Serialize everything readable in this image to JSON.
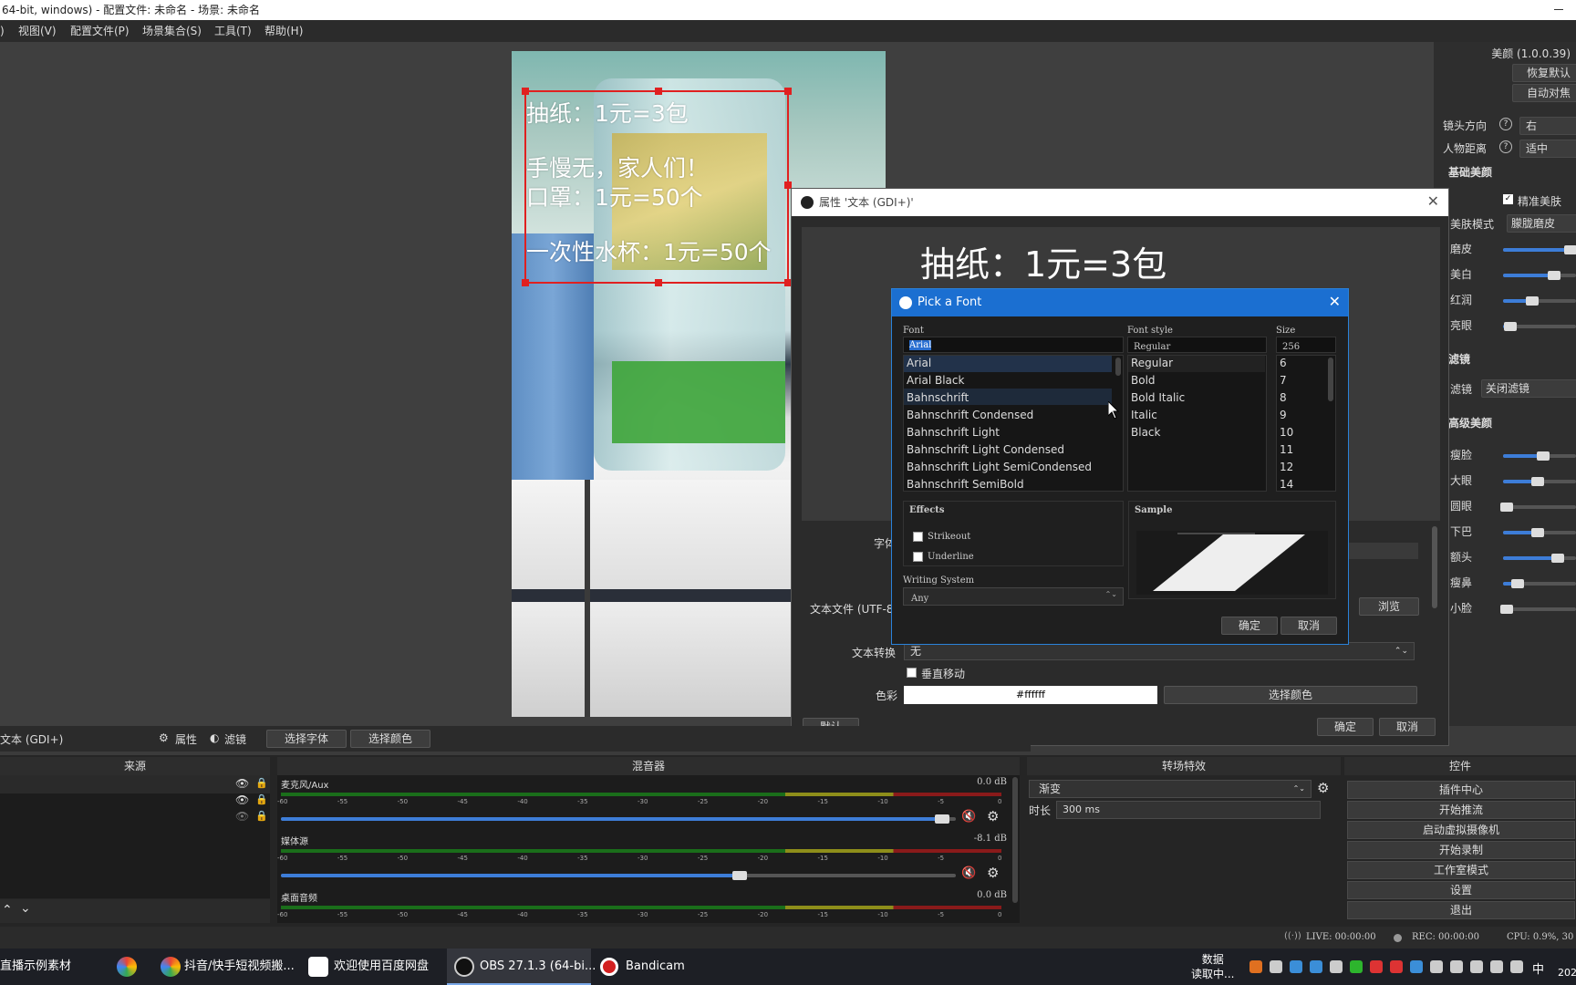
{
  "window": {
    "title": "64-bit, windows) - 配置文件: 未命名 - 场景: 未命名"
  },
  "menu": [
    "视图(V)",
    "配置文件(P)",
    "场景集合(S)",
    "工具(T)",
    "帮助(H)"
  ],
  "overlay": {
    "line1": "抽纸：1元=3包",
    "line2": "手慢无，家人们！",
    "line3": "口罩：1元=50个",
    "line4": "一次性水杯：1元=50个"
  },
  "right_panel": {
    "version": "美颜 (1.0.0.39)",
    "restore_btn": "恢复默认",
    "auto_btn": "自动对焦",
    "lens_dir_label": "镜头方向",
    "lens_dir_value": "右",
    "distance_label": "人物距离",
    "distance_value": "适中",
    "basic_title": "基础美颜",
    "precise_label": "精准美肤",
    "skin_mode_label": "美肤模式",
    "skin_mode_value": "朦胧磨皮",
    "sliders_basic": [
      {
        "label": "磨皮",
        "level": 0.92
      },
      {
        "label": "美白",
        "level": 0.7
      },
      {
        "label": "红润",
        "level": 0.4
      },
      {
        "label": "亮眼",
        "level": 0.1
      }
    ],
    "filter_title": "滤镜",
    "filter_label": "滤镜",
    "filter_value": "关闭滤镜",
    "advanced_title": "高级美颜",
    "sliders_adv": [
      {
        "label": "瘦脸",
        "level": 0.55
      },
      {
        "label": "大眼",
        "level": 0.48
      },
      {
        "label": "圆眼",
        "level": 0.05
      },
      {
        "label": "下巴",
        "level": 0.48
      },
      {
        "label": "额头",
        "level": 0.75
      },
      {
        "label": "瘦鼻",
        "level": 0.2
      },
      {
        "label": "小脸",
        "level": 0.05
      }
    ]
  },
  "props": {
    "title": "属性 '文本 (GDI+)'",
    "preview_text": "抽纸：1元=3包",
    "font_label": "字体",
    "textfile_label": "文本文件 (UTF-8",
    "browse_btn": "浏览",
    "transform_label": "文本转换",
    "transform_value": "无",
    "vertical_label": "垂直移动",
    "color_label": "色彩",
    "color_value": "#ffffff",
    "pick_color_btn": "选择颜色",
    "default_btn": "默认",
    "ok_btn": "确定",
    "cancel_btn": "取消"
  },
  "pick_font": {
    "title": "Pick a Font",
    "font_label": "Font",
    "font_value": "Arial",
    "style_label": "Font style",
    "style_value": "Regular",
    "size_label": "Size",
    "size_value": "256",
    "fonts": [
      "Arial",
      "Arial Black",
      "Bahnschrift",
      "Bahnschrift Condensed",
      "Bahnschrift Light",
      "Bahnschrift Light Condensed",
      "Bahnschrift Light SemiCondensed",
      "Bahnschrift SemiBold"
    ],
    "styles": [
      "Regular",
      "Bold",
      "Bold Italic",
      "Italic",
      "Black"
    ],
    "sizes": [
      "6",
      "7",
      "8",
      "9",
      "10",
      "11",
      "12",
      "14"
    ],
    "effects_label": "Effects",
    "strikeout_label": "Strikeout",
    "underline_label": "Underline",
    "sample_label": "Sample",
    "writing_label": "Writing System",
    "writing_value": "Any",
    "ok_btn": "确定",
    "cancel_btn": "取消"
  },
  "source_bar": {
    "source_name": "文本 (GDI+)",
    "props_btn": "属性",
    "filters_btn": "滤镜",
    "select_font_btn": "选择字体",
    "select_color_btn": "选择颜色"
  },
  "docks": {
    "sources": "来源",
    "mixer": "混音器",
    "transitions": "转场特效",
    "controls": "控件"
  },
  "mixer": [
    {
      "name": "麦克风/Aux",
      "db": "0.0 dB",
      "level": 0.99
    },
    {
      "name": "媒体源",
      "db": "-8.1 dB",
      "level": 0.69
    },
    {
      "name": "桌面音频",
      "db": "0.0 dB",
      "level": 0.99
    }
  ],
  "meter_ticks": [
    "-60",
    "-55",
    "-50",
    "-45",
    "-40",
    "-35",
    "-30",
    "-25",
    "-20",
    "-15",
    "-10",
    "-5",
    "0"
  ],
  "transitions": {
    "value": "渐变",
    "duration_label": "时长",
    "duration_value": "300 ms"
  },
  "controls": [
    "插件中心",
    "开始推流",
    "启动虚拟摄像机",
    "开始录制",
    "工作室模式",
    "设置",
    "退出"
  ],
  "status": {
    "live": "LIVE: 00:00:00",
    "rec": "REC: 00:00:00",
    "cpu": "CPU: 0.9%, 30"
  },
  "taskbar": {
    "items": [
      "直播示例素材",
      "抖音/快手短视频搬...",
      "欢迎使用百度网盘",
      "OBS 27.1.3 (64-bi...",
      "Bandicam"
    ],
    "tray_text1": "数据",
    "tray_text2": "读取中...",
    "ime": "中",
    "year": "202"
  }
}
